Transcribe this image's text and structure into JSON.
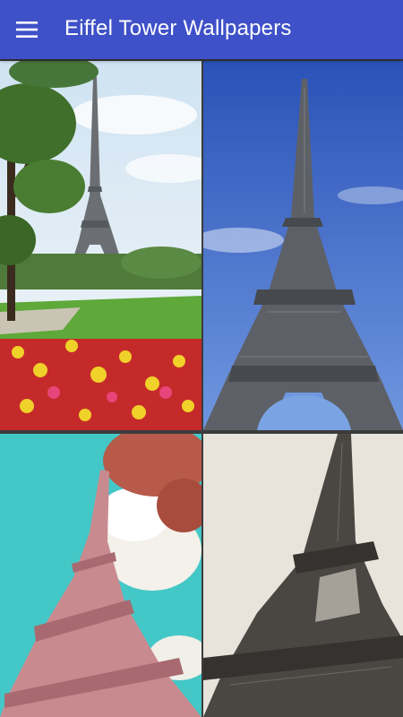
{
  "app_bar": {
    "title": "Eiffel Tower Wallpapers",
    "menu_icon": "hamburger-menu-icon",
    "background": "#3f51c8"
  },
  "wallpapers": [
    {
      "subject": "eiffel-tower-garden-flowers"
    },
    {
      "subject": "eiffel-tower-blue-sky"
    },
    {
      "subject": "eiffel-tower-pink-cyan-sky"
    },
    {
      "subject": "eiffel-tower-sepia"
    }
  ]
}
